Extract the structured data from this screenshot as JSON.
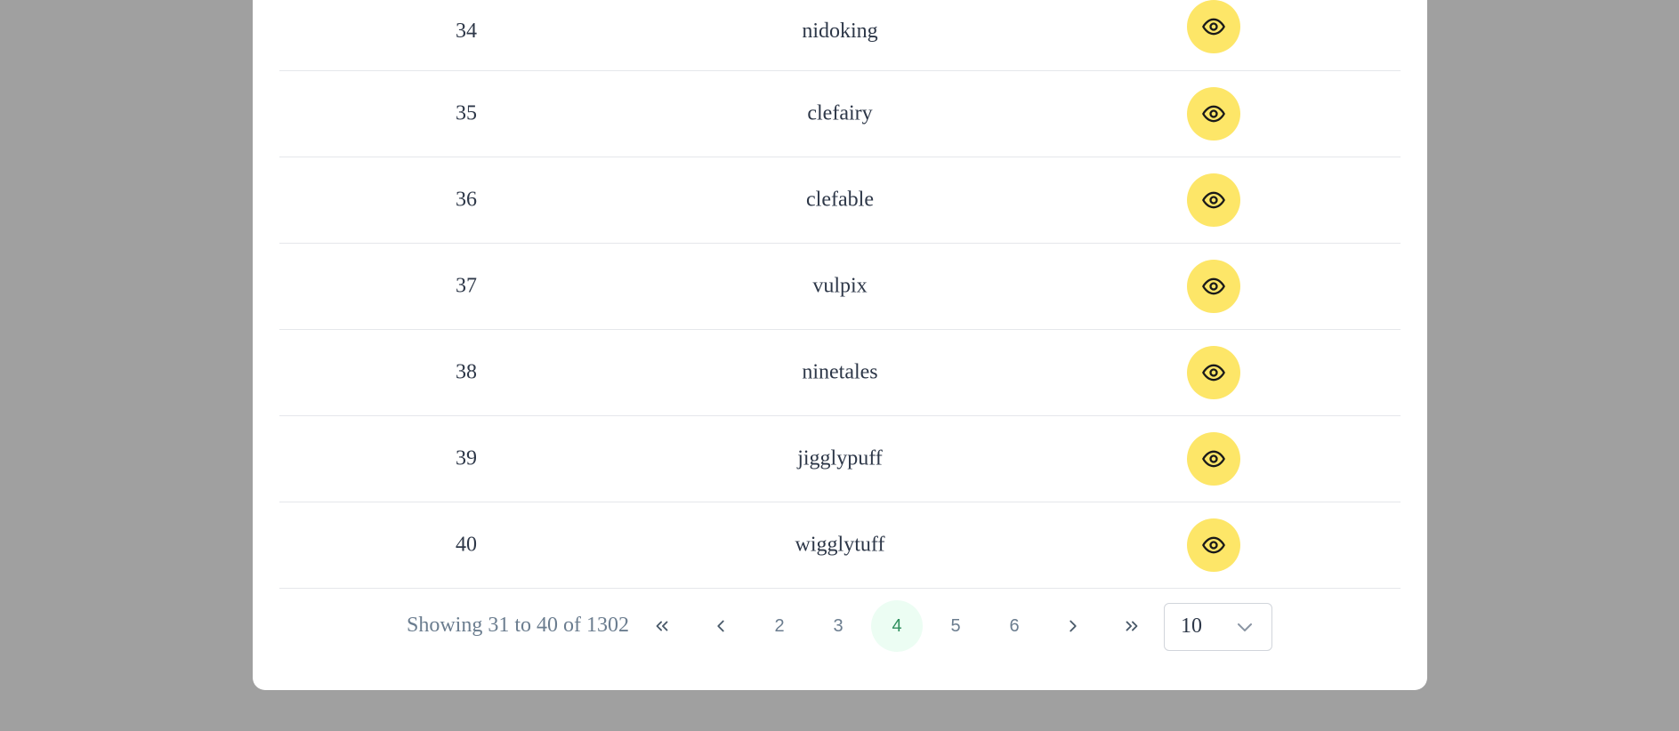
{
  "rows": [
    {
      "id": "34",
      "name": "nidoking"
    },
    {
      "id": "35",
      "name": "clefairy"
    },
    {
      "id": "36",
      "name": "clefable"
    },
    {
      "id": "37",
      "name": "vulpix"
    },
    {
      "id": "38",
      "name": "ninetales"
    },
    {
      "id": "39",
      "name": "jigglypuff"
    },
    {
      "id": "40",
      "name": "wigglytuff"
    }
  ],
  "pagination": {
    "showing_text": "Showing 31 to 40 of 1302",
    "pages": [
      "2",
      "3",
      "4",
      "5",
      "6"
    ],
    "current_page": "4",
    "per_page": "10"
  },
  "colors": {
    "background": "#a0a0a0",
    "view_button": "#fde668",
    "active_page_bg": "#ecfdf3",
    "active_page_text": "#2f8f5e"
  },
  "icons": {
    "view": "eye-icon",
    "first": "chevrons-left-icon",
    "prev": "chevron-left-icon",
    "next": "chevron-right-icon",
    "last": "chevrons-right-icon",
    "select": "chevron-down-icon"
  }
}
